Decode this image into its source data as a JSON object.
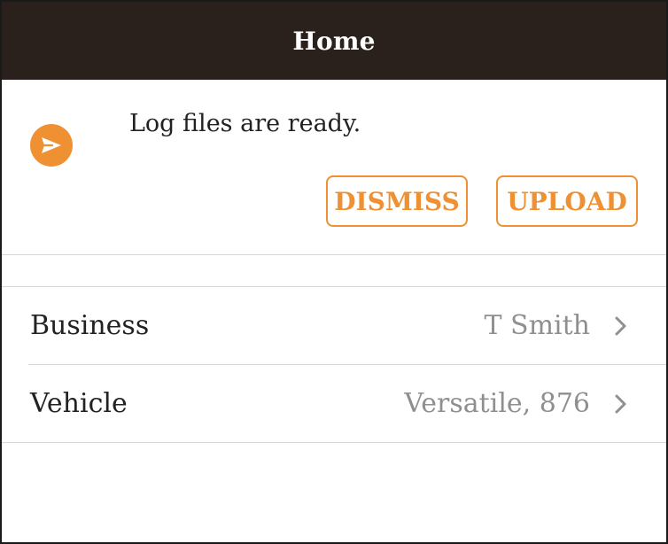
{
  "header": {
    "title": "Home"
  },
  "notification": {
    "icon": "send-icon",
    "message": "Log files are ready.",
    "dismiss_label": "DISMISS",
    "upload_label": "UPLOAD",
    "accent_color": "#EF9033"
  },
  "settings": {
    "items": [
      {
        "label": "Business",
        "value": "T Smith",
        "icon": "chevron-right-icon"
      },
      {
        "label": "Vehicle",
        "value": "Versatile, 876",
        "icon": "chevron-right-icon"
      }
    ]
  },
  "colors": {
    "header_bg": "#2B211C",
    "accent": "#EF9033",
    "secondary_text": "#8F8F8F"
  }
}
